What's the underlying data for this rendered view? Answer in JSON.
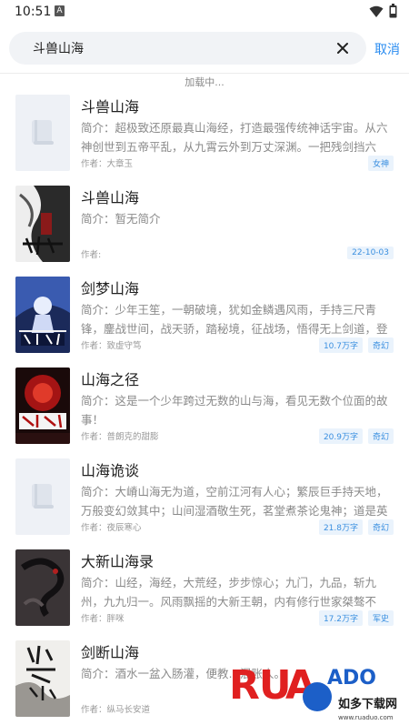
{
  "status_bar": {
    "time": "10:51",
    "notification_letter": "A"
  },
  "search": {
    "query": "斗兽山海",
    "cancel_label": "取消"
  },
  "loading_text": "加载中...",
  "colors": {
    "accent": "#2a8cf0",
    "tag_bg": "#eaf3fc",
    "search_bg": "#f1f3f6"
  },
  "books": [
    {
      "title": "斗兽山海",
      "desc": "简介：超极致还原最真山海经，打造最强传统神话宇宙。从六神创世到五帝平乱，从九霄云外到万丈深渊。一把残剑挡六道、一…",
      "author": "作者：大章玉",
      "tags": [
        "女神"
      ],
      "cover": "placeholder"
    },
    {
      "title": "斗兽山海",
      "desc": "简介：暂无简介",
      "author": "作者:",
      "tags": [
        "22-10-03"
      ],
      "cover": "ink"
    },
    {
      "title": "剑梦山海",
      "desc": "简介：少年王笙，一朝破境，犹如金鳞遇风雨，手持三尺青锋，鏖战世间，战天骄，踏秘境，征战场，悟得无上剑道，登临世…",
      "author": "作者：致虚守笃",
      "tags": [
        "10.7万字",
        "奇幻"
      ],
      "cover": "blue"
    },
    {
      "title": "山海之径",
      "desc": "简介：这是一个少年跨过无数的山与海，看见无数个位面的故事！",
      "author": "作者：普朗克的甜膨",
      "tags": [
        "20.9万字",
        "奇幻"
      ],
      "cover": "red"
    },
    {
      "title": "山海诡谈",
      "desc": "简介：大嵴山海无为道，空前江河有人心；繁辰巨手持天地，万般变幻敛其中；山间湿酒敬生死，茗堂煮茶论鬼神；道是英雄…",
      "author": "作者：夜辰寒心",
      "tags": [
        "21.8万字",
        "奇幻"
      ],
      "cover": "placeholder"
    },
    {
      "title": "大新山海录",
      "desc": "简介：山经，海经，大荒经，步步惊心；九门，九品，斩九州，九九归一。风雨飘摇的大新王朝，内有修行世家桀骜不驯。人…",
      "author": "作者：胖咪",
      "tags": [
        "17.2万字",
        "军史"
      ],
      "cover": "dragon"
    },
    {
      "title": "剑断山海",
      "desc": "简介：酒水一盆入肠灌，便教…混账人。",
      "author": "作者：纵马长安道",
      "tags": [],
      "cover": "sword"
    }
  ],
  "watermark": {
    "brand": "RUANDADO",
    "subtitle": "如多下载网",
    "url": "www.ruaduo.com"
  }
}
